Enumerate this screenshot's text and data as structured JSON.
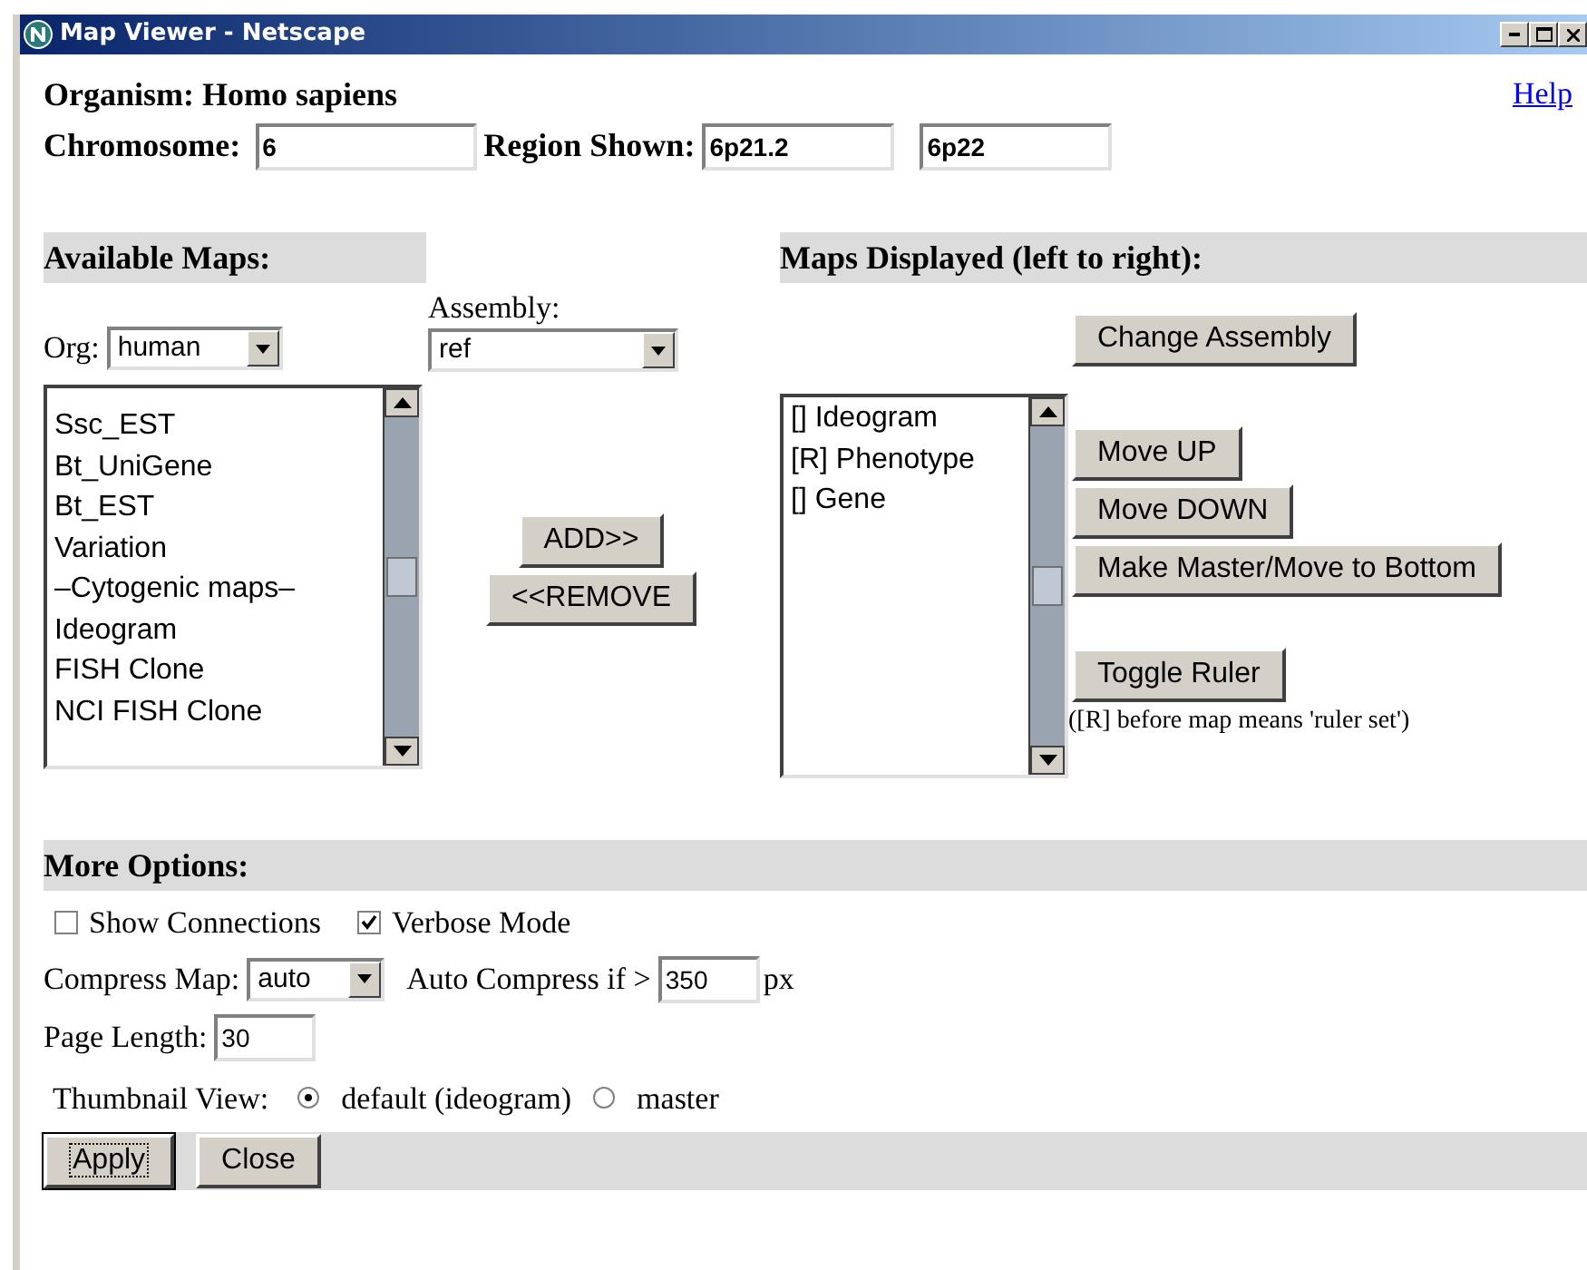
{
  "window": {
    "title": "Map Viewer - Netscape"
  },
  "header": {
    "organism": "Organism: Homo sapiens",
    "help": "Help",
    "chromosome_label": "Chromosome:",
    "chromosome": "6",
    "region_label": "Region Shown:",
    "region_from": "6p21.2",
    "region_to": "6p22"
  },
  "available": {
    "title": "Available Maps:",
    "org_label": "Org:",
    "org": "human",
    "assembly_label": "Assembly:",
    "assembly": "ref",
    "items": [
      "Ssc_EST",
      "Bt_UniGene",
      "Bt_EST",
      "Variation",
      "–Cytogenic maps–",
      "Ideogram",
      "FISH Clone",
      "NCI FISH Clone"
    ]
  },
  "transfer_buttons": [
    "ADD>>",
    "<<REMOVE"
  ],
  "displayed": {
    "title": "Maps Displayed (left to right):",
    "change_assembly": "Change Assembly",
    "items": [
      "[] Ideogram",
      "[R] Phenotype",
      "[] Gene"
    ],
    "buttons": [
      "Move UP",
      "Move DOWN",
      "Make Master/Move to Bottom"
    ],
    "toggle_ruler": "Toggle Ruler",
    "note": "([R] before map means 'ruler set')"
  },
  "options": {
    "title": "More Options:",
    "checkboxes": [
      {
        "label": "Show Connections",
        "checked": false
      },
      {
        "label": "Verbose Mode",
        "checked": true
      }
    ],
    "compress_label": "Compress Map:",
    "compress": "auto",
    "auto_label": "Auto Compress if >",
    "auto_value": "350",
    "auto_unit": "px",
    "page_length_label": "Page Length:",
    "page_length": "30",
    "thumbnail_label": "Thumbnail View:",
    "thumbnail": [
      {
        "label": "default (ideogram)",
        "selected": true
      },
      {
        "label": "master",
        "selected": false
      }
    ]
  },
  "footer_buttons": [
    {
      "label": "Apply",
      "focused": true
    },
    {
      "label": "Close",
      "focused": false
    }
  ]
}
